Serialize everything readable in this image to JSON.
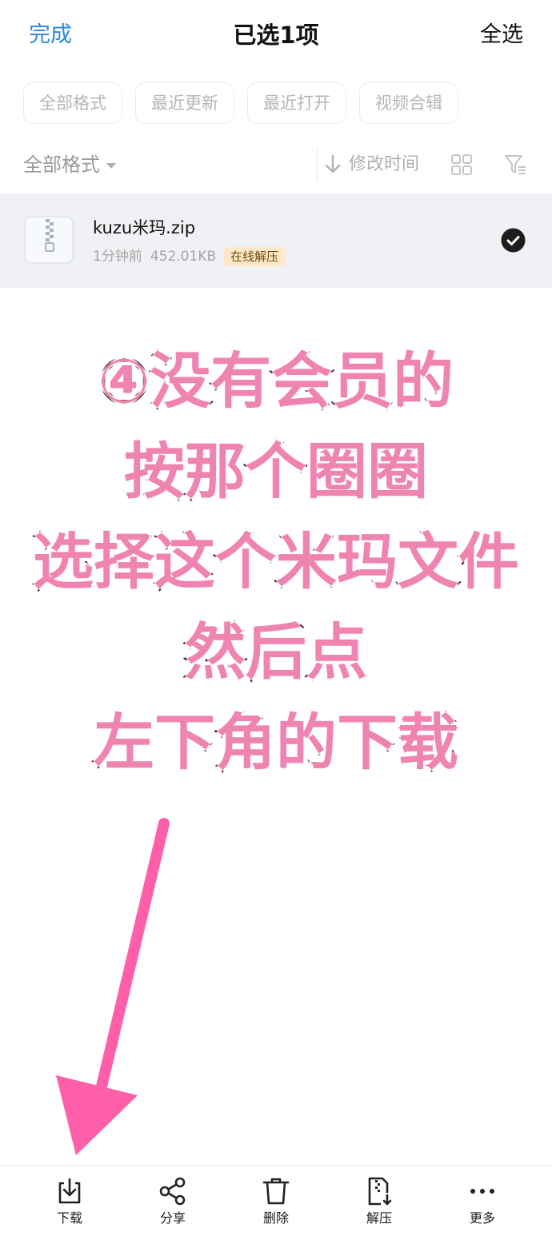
{
  "header": {
    "done_label": "完成",
    "title": "已选1项",
    "select_all_label": "全选"
  },
  "chips": [
    {
      "label": "全部格式"
    },
    {
      "label": "最近更新"
    },
    {
      "label": "最近打开"
    },
    {
      "label": "视频合辑"
    }
  ],
  "sortbar": {
    "format_label": "全部格式",
    "sort_label": "修改时间"
  },
  "file": {
    "name": "kuzu米玛.zip",
    "time": "1分钟前",
    "size": "452.01KB",
    "badge": "在线解压",
    "selected": true
  },
  "overlay": {
    "lines": [
      "④没有会员的",
      "按那个圈圈",
      "选择这个米玛文件",
      "然后点",
      "左下角的下载"
    ],
    "text_color": "#ef84b0",
    "outline_color": "#3a1524"
  },
  "arrow_color": "#ff5fa8",
  "toolbar": {
    "items": [
      {
        "label": "下载",
        "icon": "download-icon"
      },
      {
        "label": "分享",
        "icon": "share-icon"
      },
      {
        "label": "删除",
        "icon": "trash-icon"
      },
      {
        "label": "解压",
        "icon": "unzip-icon"
      },
      {
        "label": "更多",
        "icon": "more-icon"
      }
    ]
  },
  "colors": {
    "accent": "#2e86de",
    "selected_row_bg": "#f0f1f4",
    "badge_bg": "#ffe8c6"
  }
}
